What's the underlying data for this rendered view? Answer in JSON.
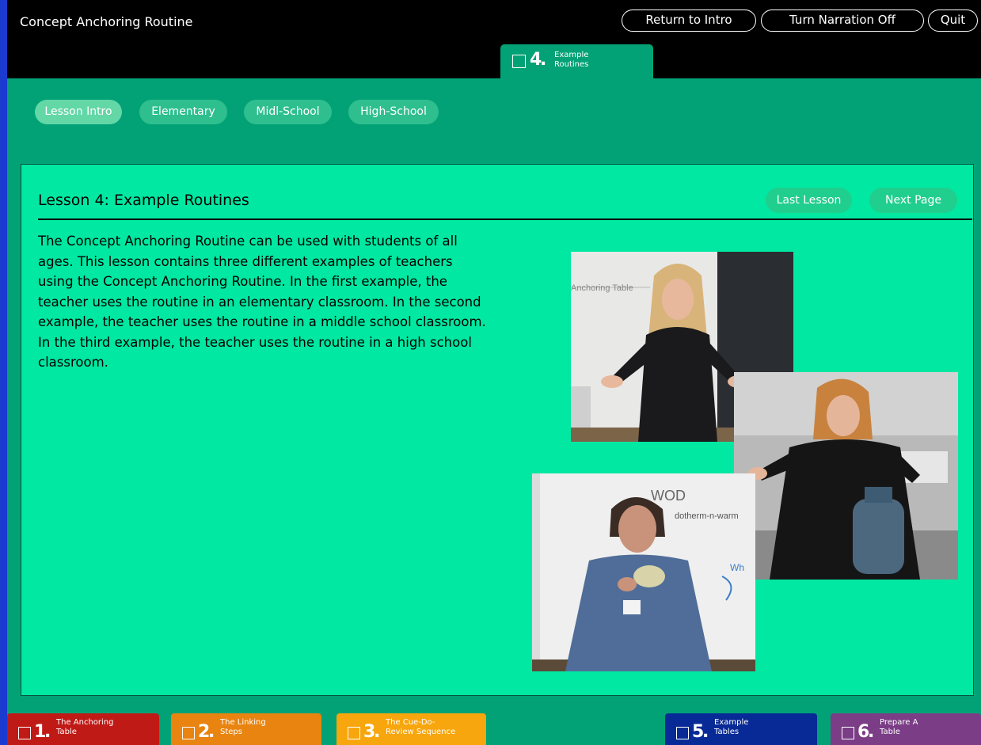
{
  "app_title": "Concept Anchoring Routine",
  "top_buttons": {
    "return": "Return to Intro",
    "narration": "Turn Narration Off",
    "quit": "Quit"
  },
  "active_tab": {
    "number": "4",
    "label_line1": "Example",
    "label_line2": "Routines"
  },
  "subnav": [
    "Lesson Intro",
    "Elementary",
    "Midl-School",
    "High-School"
  ],
  "lesson": {
    "title": "Lesson 4: Example Routines",
    "last_button": "Last Lesson",
    "next_button": "Next Page",
    "body": "The Concept Anchoring Routine can be used with students of all ages.  This lesson contains three different examples of teachers using the Concept Anchoring Routine. In the first example, the teacher uses the routine in an elementary classroom. In the second example, the teacher uses the routine in a middle school classroom. In the third example, the teacher uses the routine in a high school classroom."
  },
  "photos": {
    "photo1_board_text": "Anchoring Table",
    "photo3_board_text_1": "WOD",
    "photo3_board_text_2": "dotherm-n-warm",
    "photo3_board_text_3": "Wh"
  },
  "bottom_tabs": [
    {
      "number": "1",
      "line1": "The Anchoring",
      "line2": "Table",
      "color": "#c01a16"
    },
    {
      "number": "2",
      "line1": "The Linking",
      "line2": "Steps",
      "color": "#e8840f"
    },
    {
      "number": "3",
      "line1": "The Cue-Do-",
      "line2": "Review Sequence",
      "color": "#f7a60d"
    },
    {
      "number": "5",
      "line1": "Example",
      "line2": "Tables",
      "color": "#082a96"
    },
    {
      "number": "6",
      "line1": "Prepare A",
      "line2": "Table",
      "color": "#7a3d86"
    }
  ]
}
